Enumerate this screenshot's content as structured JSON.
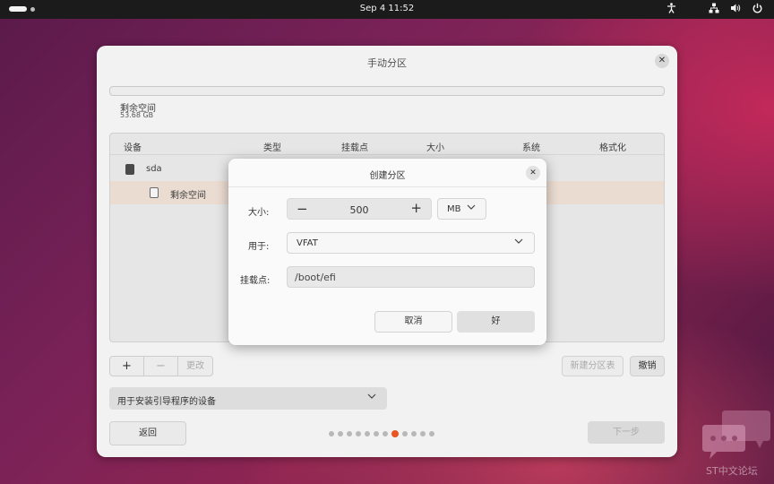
{
  "topbar": {
    "clock": "Sep 4  11:52",
    "icons": [
      "accessibility-icon",
      "network-icon",
      "volume-icon",
      "power-icon"
    ]
  },
  "window": {
    "title": "手动分区",
    "close": "✕",
    "free_space": {
      "label": "剩余空间",
      "size": "53.68 GB"
    },
    "table": {
      "columns": [
        "设备",
        "类型",
        "挂载点",
        "大小",
        "系统",
        "格式化"
      ],
      "rows": [
        {
          "device": "sda"
        },
        {
          "device": "剩余空间"
        }
      ]
    },
    "toolbar": {
      "add": "+",
      "remove": "−",
      "change": "更改"
    },
    "new_table_button": "新建分区表",
    "revert_button": "撤销",
    "bootloader": {
      "label": "用于安装引导程序的设备",
      "chevron": "∨"
    },
    "back_button": "返回",
    "next_button": "下一步",
    "pager": {
      "total": 12,
      "active_index": 7
    }
  },
  "dialog": {
    "title": "创建分区",
    "close": "✕",
    "size_label": "大小:",
    "size_minus": "−",
    "size_value": "500",
    "size_plus": "+",
    "unit": "MB",
    "use_label": "用于:",
    "use_value": "VFAT",
    "mount_label": "挂载点:",
    "mount_value": "/boot/efi",
    "cancel_button": "取消",
    "ok_button": "好"
  },
  "watermark": {
    "text": "ST中文论坛"
  },
  "colors": {
    "accent": "#e95420",
    "topbar": "#1b1b1b",
    "selected_row": "#ebdcd1"
  }
}
